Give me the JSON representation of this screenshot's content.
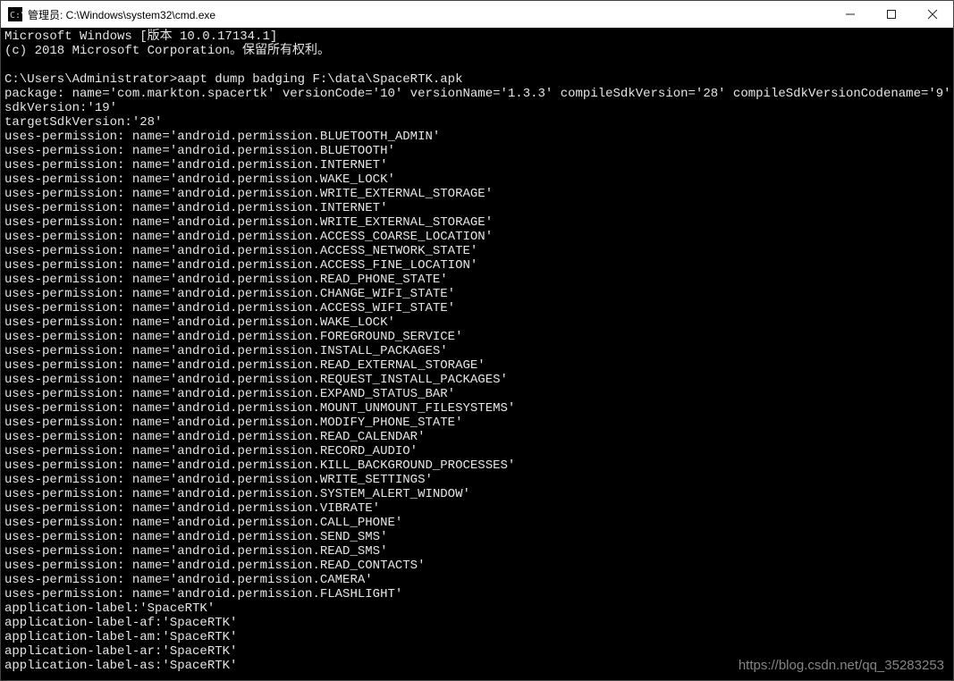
{
  "window": {
    "title": "管理员: C:\\Windows\\system32\\cmd.exe"
  },
  "terminal": {
    "header1": "Microsoft Windows [版本 10.0.17134.1]",
    "header2": "(c) 2018 Microsoft Corporation。保留所有权利。",
    "prompt": "C:\\Users\\Administrator>",
    "command": "aapt dump badging F:\\data\\SpaceRTK.apk",
    "package_line": "package: name='com.markton.spacertk' versionCode='10' versionName='1.3.3' compileSdkVersion='28' compileSdkVersionCodename='9'",
    "sdk_version": "sdkVersion:'19'",
    "target_sdk": "targetSdkVersion:'28'",
    "permissions": [
      "uses-permission: name='android.permission.BLUETOOTH_ADMIN'",
      "uses-permission: name='android.permission.BLUETOOTH'",
      "uses-permission: name='android.permission.INTERNET'",
      "uses-permission: name='android.permission.WAKE_LOCK'",
      "uses-permission: name='android.permission.WRITE_EXTERNAL_STORAGE'",
      "uses-permission: name='android.permission.INTERNET'",
      "uses-permission: name='android.permission.WRITE_EXTERNAL_STORAGE'",
      "uses-permission: name='android.permission.ACCESS_COARSE_LOCATION'",
      "uses-permission: name='android.permission.ACCESS_NETWORK_STATE'",
      "uses-permission: name='android.permission.ACCESS_FINE_LOCATION'",
      "uses-permission: name='android.permission.READ_PHONE_STATE'",
      "uses-permission: name='android.permission.CHANGE_WIFI_STATE'",
      "uses-permission: name='android.permission.ACCESS_WIFI_STATE'",
      "uses-permission: name='android.permission.WAKE_LOCK'",
      "uses-permission: name='android.permission.FOREGROUND_SERVICE'",
      "uses-permission: name='android.permission.INSTALL_PACKAGES'",
      "uses-permission: name='android.permission.READ_EXTERNAL_STORAGE'",
      "uses-permission: name='android.permission.REQUEST_INSTALL_PACKAGES'",
      "uses-permission: name='android.permission.EXPAND_STATUS_BAR'",
      "uses-permission: name='android.permission.MOUNT_UNMOUNT_FILESYSTEMS'",
      "uses-permission: name='android.permission.MODIFY_PHONE_STATE'",
      "uses-permission: name='android.permission.READ_CALENDAR'",
      "uses-permission: name='android.permission.RECORD_AUDIO'",
      "uses-permission: name='android.permission.KILL_BACKGROUND_PROCESSES'",
      "uses-permission: name='android.permission.WRITE_SETTINGS'",
      "uses-permission: name='android.permission.SYSTEM_ALERT_WINDOW'",
      "uses-permission: name='android.permission.VIBRATE'",
      "uses-permission: name='android.permission.CALL_PHONE'",
      "uses-permission: name='android.permission.SEND_SMS'",
      "uses-permission: name='android.permission.READ_SMS'",
      "uses-permission: name='android.permission.READ_CONTACTS'",
      "uses-permission: name='android.permission.CAMERA'",
      "uses-permission: name='android.permission.FLASHLIGHT'"
    ],
    "labels": [
      "application-label:'SpaceRTK'",
      "application-label-af:'SpaceRTK'",
      "application-label-am:'SpaceRTK'",
      "application-label-ar:'SpaceRTK'",
      "application-label-as:'SpaceRTK'"
    ]
  },
  "watermark": "https://blog.csdn.net/qq_35283253"
}
